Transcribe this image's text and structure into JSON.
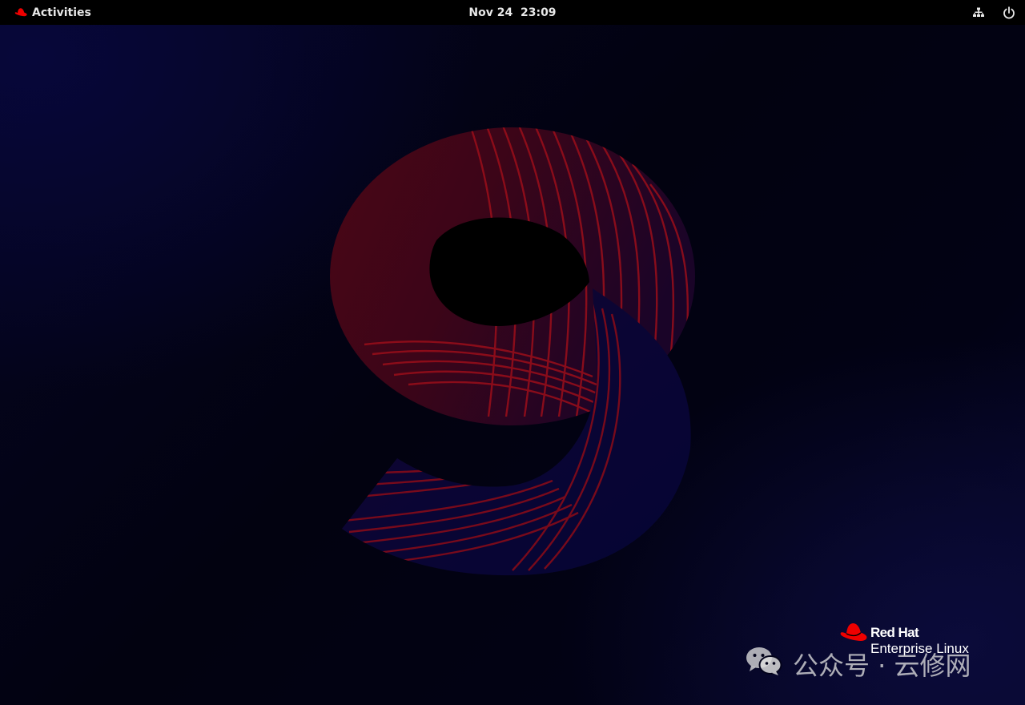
{
  "topbar": {
    "activities_label": "Activities",
    "clock": "Nov 24  23:09",
    "network_icon": "network-wired-icon",
    "power_icon": "power-icon"
  },
  "desktop": {
    "wallpaper_number": "9",
    "brand": {
      "name": "Red Hat",
      "product": "Enterprise Linux"
    },
    "watermark": {
      "icon": "wechat-icon",
      "text": "公众号 · 云修网"
    }
  },
  "colors": {
    "topbar": "#000000",
    "redhat_red": "#ee0000",
    "wallpaper_red": "#8a0012",
    "wallpaper_navy": "#050522"
  }
}
